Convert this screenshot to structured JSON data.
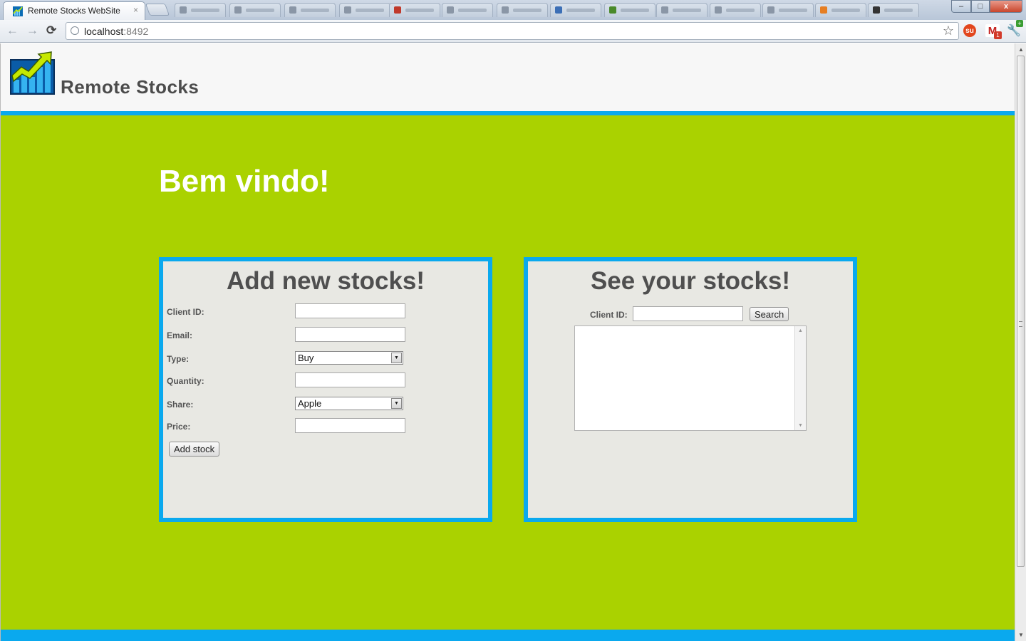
{
  "browser": {
    "tab_title": "Remote Stocks WebSite",
    "tab_close": "×",
    "url_host": "localhost",
    "url_port": ":8492",
    "nav": {
      "back": "←",
      "forward": "→",
      "reload": "⟳"
    },
    "star": "☆",
    "extensions": {
      "stumbleupon": "su",
      "gmail": "M",
      "gmail_badge": "1",
      "wrench": "🔧",
      "plus": "+"
    },
    "window_controls": {
      "minimize": "–",
      "maximize": "□",
      "close": "x"
    },
    "scroll_up": "▲",
    "scroll_down": "▼"
  },
  "header": {
    "title": "Remote Stocks"
  },
  "main": {
    "welcome": "Bem vindo!"
  },
  "add_panel": {
    "title": "Add new stocks!",
    "fields": {
      "client_id": "Client ID:",
      "email": "Email:",
      "type": "Type:",
      "quantity": "Quantity:",
      "share": "Share:",
      "price": "Price:"
    },
    "type_selected": "Buy",
    "share_selected": "Apple",
    "submit": "Add stock"
  },
  "see_panel": {
    "title": "See your stocks!",
    "client_id_label": "Client ID:",
    "search_button": "Search",
    "results_text": ""
  },
  "colors": {
    "accent": "#0aa9ee",
    "background": "#aad200",
    "panel": "#e8e8e3",
    "heading": "#4f4f4f"
  }
}
